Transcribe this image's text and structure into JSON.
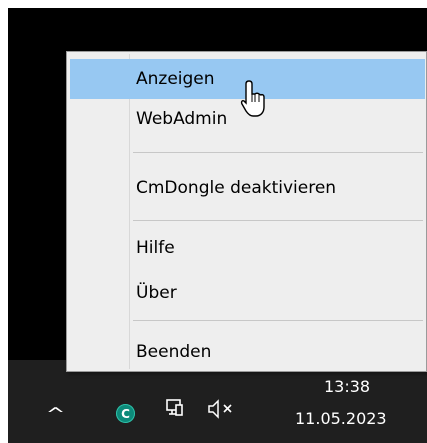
{
  "menu": {
    "items": [
      {
        "label": "Anzeigen",
        "highlighted": true
      },
      {
        "label": "WebAdmin"
      },
      {
        "label": "CmDongle deaktivieren"
      },
      {
        "label": "Hilfe"
      },
      {
        "label": "Über"
      },
      {
        "label": "Beenden"
      }
    ]
  },
  "taskbar": {
    "icons": [
      "chevron-up-icon",
      "cmdongle-tray-icon",
      "network-icon",
      "volume-muted-icon"
    ],
    "chevron": "^",
    "cm_glyph": "C",
    "clock_time": "13:38",
    "clock_date": "11.05.2023"
  },
  "colors": {
    "highlight": "#97c8f2",
    "menu_bg": "#eeeeee",
    "taskbar_bg": "#1f1f1f",
    "desktop_bg": "#000000",
    "cm_icon": "#0d8a7a"
  }
}
